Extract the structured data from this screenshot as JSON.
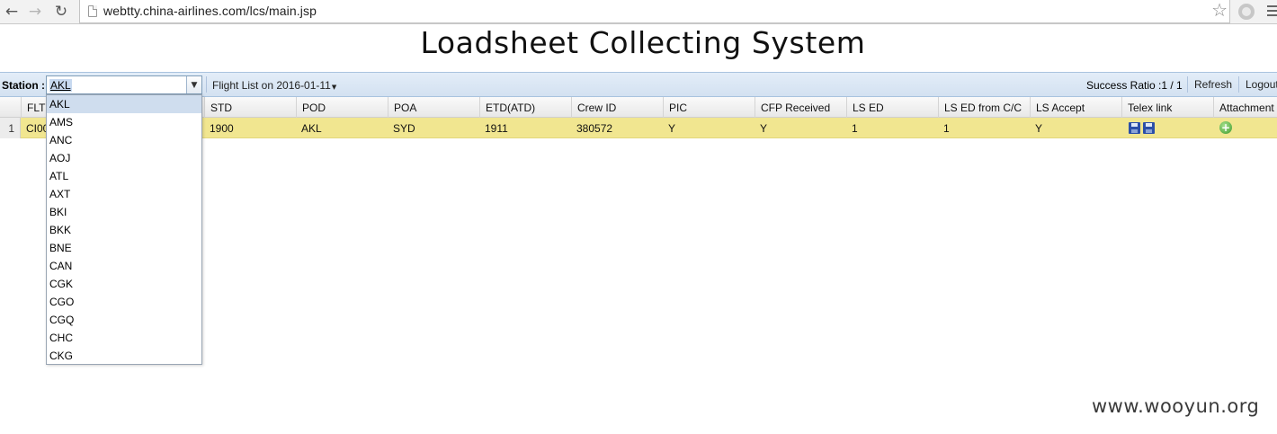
{
  "browser": {
    "url": "webtty.china-airlines.com/lcs/main.jsp"
  },
  "app": {
    "title": "Loadsheet Collecting System"
  },
  "toolbar": {
    "station_label": "Station :",
    "station_value": "AKL",
    "flight_list_label": "Flight List on 2016-01-11",
    "success_ratio": "Success Ratio :1 / 1",
    "refresh_label": "Refresh",
    "logout_label": "Logout"
  },
  "grid": {
    "columns": [
      "FLT",
      "STD",
      "POD",
      "POA",
      "ETD(ATD)",
      "Crew ID",
      "PIC",
      "CFP Received",
      "LS ED",
      "LS ED from C/C",
      "LS Accept",
      "Telex link",
      "Attachment"
    ],
    "rows": [
      {
        "num": "1",
        "flt": "CI00",
        "std": "1900",
        "pod": "AKL",
        "poa": "SYD",
        "etd": "1911",
        "crew_id": "380572",
        "pic": "Y",
        "cfp_received": "Y",
        "ls_ed": "1",
        "ls_ed_from_cc": "1",
        "ls_accept": "Y"
      }
    ]
  },
  "station_options": [
    "AKL",
    "AMS",
    "ANC",
    "AOJ",
    "ATL",
    "AXT",
    "BKI",
    "BKK",
    "BNE",
    "CAN",
    "CGK",
    "CGO",
    "CGQ",
    "CHC",
    "CKG"
  ],
  "watermark": "www.wooyun.org",
  "icons": {
    "back": "back-arrow-icon",
    "forward": "forward-arrow-icon",
    "reload": "reload-icon",
    "bookmark": "star-icon",
    "menu": "hamburger-menu-icon",
    "telex": "save-disk-icon",
    "attachment": "add-circle-icon"
  },
  "colors": {
    "toolbar": "#d8e5f3",
    "selected_row": "#f1e690",
    "attachment_icon": "#3e9a2a"
  }
}
